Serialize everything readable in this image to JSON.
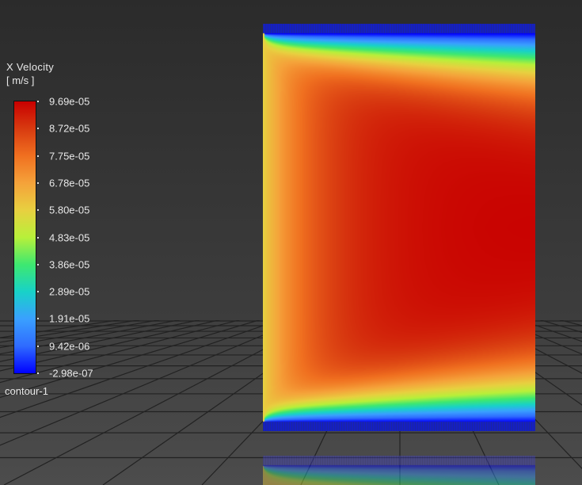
{
  "legend": {
    "title": "X Velocity",
    "units": "[ m/s ]",
    "name": "contour-1",
    "ticks": [
      "9.69e-05",
      "8.72e-05",
      "7.75e-05",
      "6.78e-05",
      "5.80e-05",
      "4.83e-05",
      "3.86e-05",
      "2.89e-05",
      "1.91e-05",
      "9.42e-06",
      "-2.98e-07"
    ],
    "colormap": [
      "#0000ff",
      "#2f6bff",
      "#3aa0ff",
      "#18d2c8",
      "#3ee870",
      "#b8f03a",
      "#e8d040",
      "#f5a23a",
      "#f07020",
      "#d83a10",
      "#c80000"
    ]
  },
  "colors": {
    "wall_band": "#1a22c8"
  },
  "chart_data": {
    "type": "heatmap",
    "title": "X Velocity [ m/s ]",
    "variable": "X Velocity",
    "units": "m/s",
    "range": [
      -2.98e-07,
      9.69e-05
    ],
    "colorbar_ticks": [
      9.69e-05,
      8.72e-05,
      7.75e-05,
      6.78e-05,
      5.8e-05,
      4.83e-05,
      3.86e-05,
      2.89e-05,
      1.91e-05,
      9.42e-06,
      -2.98e-07
    ],
    "description_of_field": "channel flow: uniform inlet ~5.8e-05 at left, developing boundary layers at top and bottom walls (~0), core ~9.7e-05"
  }
}
